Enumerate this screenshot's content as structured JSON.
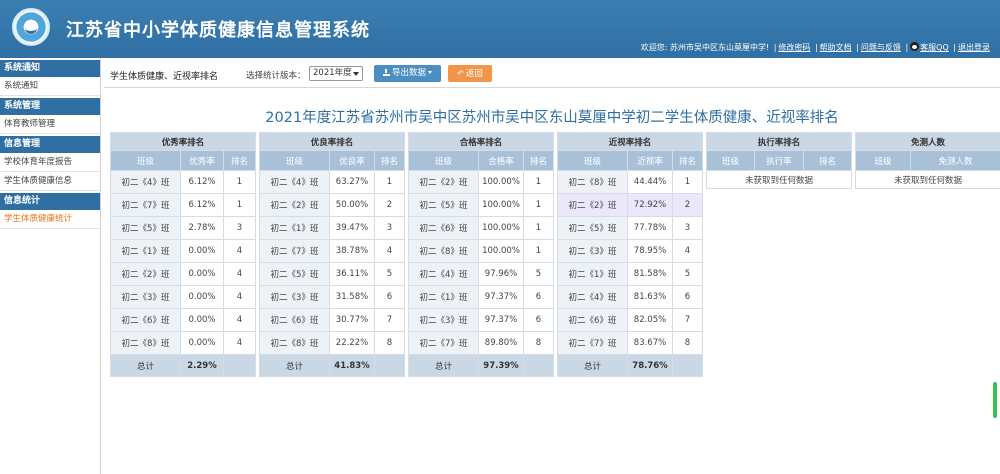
{
  "app": {
    "title": "江苏省中小学体质健康信息管理系统"
  },
  "userbar": {
    "welcome": "欢迎您: 苏州市吴中区东山莫厘中学!",
    "links": [
      "修改密码",
      "帮助文档",
      "问题与反馈",
      "客服QQ",
      "退出登录"
    ]
  },
  "sidebar": {
    "groups": [
      {
        "title": "系统通知",
        "items": [
          "系统通知"
        ]
      },
      {
        "title": "系统管理",
        "items": [
          "体育教师管理"
        ]
      },
      {
        "title": "信息管理",
        "items": [
          "学校体育年度报告",
          "学生体质健康信息"
        ]
      },
      {
        "title": "信息统计",
        "items": [
          "学生体质健康统计"
        ]
      }
    ],
    "active_item": "学生体质健康统计"
  },
  "toolbar": {
    "page_label": "学生体质健康、近视率排名",
    "version_label": "选择统计版本：",
    "version_value": "2021年度",
    "export_label": "导出数据",
    "back_label": "返回"
  },
  "report_title": "2021年度江苏省苏州市吴中区苏州市吴中区东山莫厘中学初二学生体质健康、近视率排名",
  "tables": [
    {
      "caption": "优秀率排名",
      "headers": [
        "班级",
        "优秀率",
        "排名"
      ],
      "rows": [
        [
          "初二《4》班",
          "6.12%",
          "1"
        ],
        [
          "初二《7》班",
          "6.12%",
          "1"
        ],
        [
          "初二《5》班",
          "2.78%",
          "3"
        ],
        [
          "初二《1》班",
          "0.00%",
          "4"
        ],
        [
          "初二《2》班",
          "0.00%",
          "4"
        ],
        [
          "初二《3》班",
          "0.00%",
          "4"
        ],
        [
          "初二《6》班",
          "0.00%",
          "4"
        ],
        [
          "初二《8》班",
          "0.00%",
          "4"
        ]
      ],
      "total": [
        "总计",
        "2.29%",
        ""
      ]
    },
    {
      "caption": "优良率排名",
      "headers": [
        "班级",
        "优良率",
        "排名"
      ],
      "rows": [
        [
          "初二《4》班",
          "63.27%",
          "1"
        ],
        [
          "初二《2》班",
          "50.00%",
          "2"
        ],
        [
          "初二《1》班",
          "39.47%",
          "3"
        ],
        [
          "初二《7》班",
          "38.78%",
          "4"
        ],
        [
          "初二《5》班",
          "36.11%",
          "5"
        ],
        [
          "初二《3》班",
          "31.58%",
          "6"
        ],
        [
          "初二《6》班",
          "30.77%",
          "7"
        ],
        [
          "初二《8》班",
          "22.22%",
          "8"
        ]
      ],
      "total": [
        "总计",
        "41.83%",
        ""
      ]
    },
    {
      "caption": "合格率排名",
      "headers": [
        "班级",
        "合格率",
        "排名"
      ],
      "rows": [
        [
          "初二《2》班",
          "100.00%",
          "1"
        ],
        [
          "初二《5》班",
          "100.00%",
          "1"
        ],
        [
          "初二《6》班",
          "100.00%",
          "1"
        ],
        [
          "初二《8》班",
          "100.00%",
          "1"
        ],
        [
          "初二《4》班",
          "97.96%",
          "5"
        ],
        [
          "初二《1》班",
          "97.37%",
          "6"
        ],
        [
          "初二《3》班",
          "97.37%",
          "6"
        ],
        [
          "初二《7》班",
          "89.80%",
          "8"
        ]
      ],
      "total": [
        "总计",
        "97.39%",
        ""
      ]
    },
    {
      "caption": "近视率排名",
      "headers": [
        "班级",
        "近视率",
        "排名"
      ],
      "rows": [
        [
          "初二《8》班",
          "44.44%",
          "1"
        ],
        [
          "初二《2》班",
          "72.92%",
          "2"
        ],
        [
          "初二《5》班",
          "77.78%",
          "3"
        ],
        [
          "初二《3》班",
          "78.95%",
          "4"
        ],
        [
          "初二《1》班",
          "81.58%",
          "5"
        ],
        [
          "初二《4》班",
          "81.63%",
          "6"
        ],
        [
          "初二《6》班",
          "82.05%",
          "7"
        ],
        [
          "初二《7》班",
          "83.67%",
          "8"
        ]
      ],
      "highlight_row": 1,
      "total": [
        "总计",
        "78.76%",
        ""
      ]
    },
    {
      "caption": "执行率排名",
      "headers": [
        "班级",
        "执行率",
        "排名"
      ],
      "rows": [],
      "empty_text": "未获取到任何数据"
    },
    {
      "caption": "免测人数",
      "headers": [
        "班级",
        "免测人数"
      ],
      "rows": [],
      "empty_text": "未获取到任何数据"
    }
  ]
}
